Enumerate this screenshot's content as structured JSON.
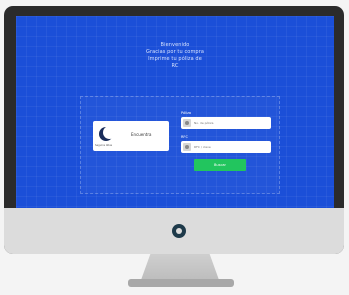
{
  "screen": {
    "welcome_lines": [
      "Bienvenido",
      "Gracias por tu compra",
      "Imprime tu póliza de",
      "RC"
    ]
  },
  "logo": {
    "brand_name": "Encuentra",
    "caption": "Seguros Atlas"
  },
  "form": {
    "field1_label": "Póliza",
    "field1_placeholder": "No. de póliza",
    "field2_label": "RFC",
    "field2_placeholder": "RFC / clave",
    "submit_label": "Buscar"
  },
  "colors": {
    "screen_bg": "#1b4fd8",
    "button": "#22c55e",
    "bezel": "#2b2b2b",
    "chin": "#dcdcdc"
  },
  "icons": {
    "power": "power-icon",
    "user": "user-icon",
    "key": "key-icon"
  }
}
